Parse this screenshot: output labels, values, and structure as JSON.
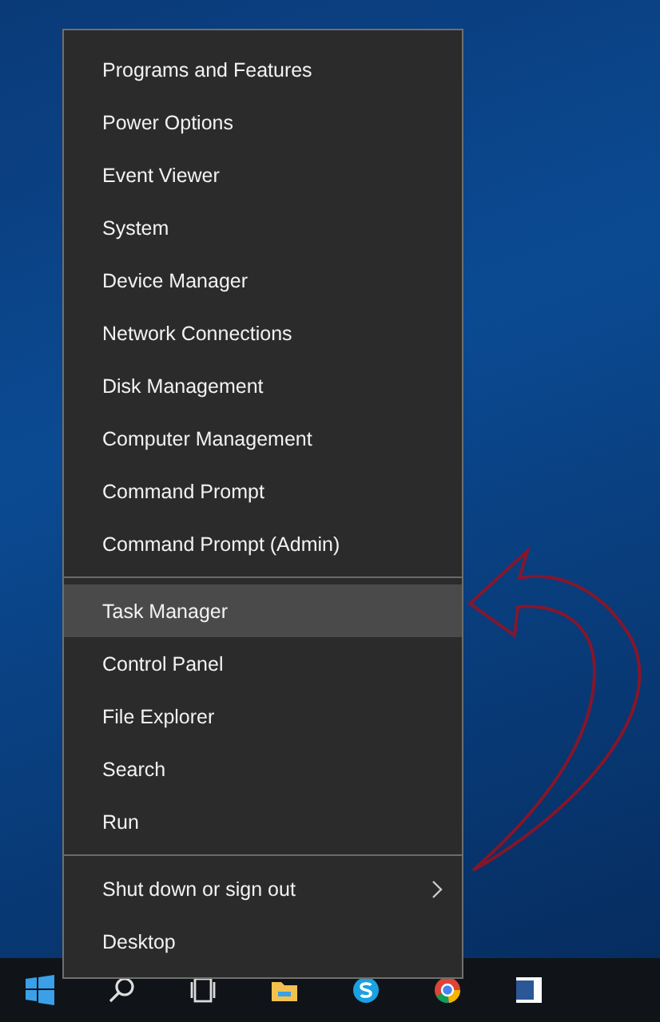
{
  "menu": {
    "groups": [
      {
        "items": [
          {
            "label": "Programs and Features",
            "selected": false,
            "submenu": false
          },
          {
            "label": "Power Options",
            "selected": false,
            "submenu": false
          },
          {
            "label": "Event Viewer",
            "selected": false,
            "submenu": false
          },
          {
            "label": "System",
            "selected": false,
            "submenu": false
          },
          {
            "label": "Device Manager",
            "selected": false,
            "submenu": false
          },
          {
            "label": "Network Connections",
            "selected": false,
            "submenu": false
          },
          {
            "label": "Disk Management",
            "selected": false,
            "submenu": false
          },
          {
            "label": "Computer Management",
            "selected": false,
            "submenu": false
          },
          {
            "label": "Command Prompt",
            "selected": false,
            "submenu": false
          },
          {
            "label": "Command Prompt (Admin)",
            "selected": false,
            "submenu": false
          }
        ]
      },
      {
        "items": [
          {
            "label": "Task Manager",
            "selected": true,
            "submenu": false
          },
          {
            "label": "Control Panel",
            "selected": false,
            "submenu": false
          },
          {
            "label": "File Explorer",
            "selected": false,
            "submenu": false
          },
          {
            "label": "Search",
            "selected": false,
            "submenu": false
          },
          {
            "label": "Run",
            "selected": false,
            "submenu": false
          }
        ]
      },
      {
        "items": [
          {
            "label": "Shut down or sign out",
            "selected": false,
            "submenu": true
          },
          {
            "label": "Desktop",
            "selected": false,
            "submenu": false
          }
        ]
      }
    ]
  }
}
